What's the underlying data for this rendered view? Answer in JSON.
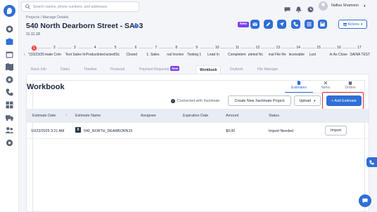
{
  "header": {
    "search_placeholder": "Search names, phone numbers, and addresses",
    "user_name": "Nafisa Shamoon",
    "user_caret": "▾"
  },
  "breadcrumb": "Projects / Manage Details",
  "project": {
    "title": "540 North Dearborn Street - SAI 3",
    "info_icon": "i",
    "subtitle": "11.11.18",
    "new_badge": "New",
    "actions_label": "Actions",
    "actions_caret": "▾"
  },
  "stepper": {
    "numbers": [
      "1",
      "2",
      "3",
      "4",
      "5",
      "6",
      "7",
      "8",
      "9",
      "10",
      "11",
      "12",
      "13",
      "14",
      "15",
      "16",
      "17"
    ],
    "labels": [
      "\"(10/23/25",
      "mate Com",
      "Test Sales In",
      "Productinted",
      "acted/Sc",
      "Closed",
      "1. Sales",
      "nal Invoice",
      "Testing 1",
      "Lead In",
      "Completem",
      "pleted Nc",
      "inal File Re",
      "leceivable",
      "Lost",
      "rk As Close",
      "SAINA TEST"
    ],
    "left_arrow": "‹"
  },
  "tabs": [
    "Basic Info",
    "Dates",
    "Timeline",
    "Financial",
    "Payment Requests",
    "Workbook",
    "Drybook",
    "File Manager"
  ],
  "tab_new_badge": "New",
  "workbook": {
    "title": "Workbook",
    "right_tabs": [
      "Estimates",
      "Items",
      "Orders"
    ],
    "connected_text": "Connected with Xactimate",
    "check_icon": "✓",
    "create_button": "Create New Xactimate Project",
    "upload_button": "Upload",
    "upload_caret": "▾",
    "add_button": "+ Add Estimate"
  },
  "table": {
    "columns": [
      "Estimate Date",
      "Estimate Name",
      "Assignee",
      "Expiration Date",
      "Amount",
      "Status"
    ],
    "sort_icon": "↓",
    "rows": [
      {
        "date": "10/23/2025 3:21 AM",
        "name": "540_NORTH_DEARBORN15",
        "badge": "X",
        "assignee": "",
        "expiration": "",
        "amount": "$0.00",
        "status": "Import Needed",
        "action": "Import"
      }
    ]
  },
  "colors": {
    "accent": "#2f6fd6",
    "active_step": "#f04646",
    "badge_purple": "#7b3ff2",
    "highlight": "#ee2a2a"
  }
}
